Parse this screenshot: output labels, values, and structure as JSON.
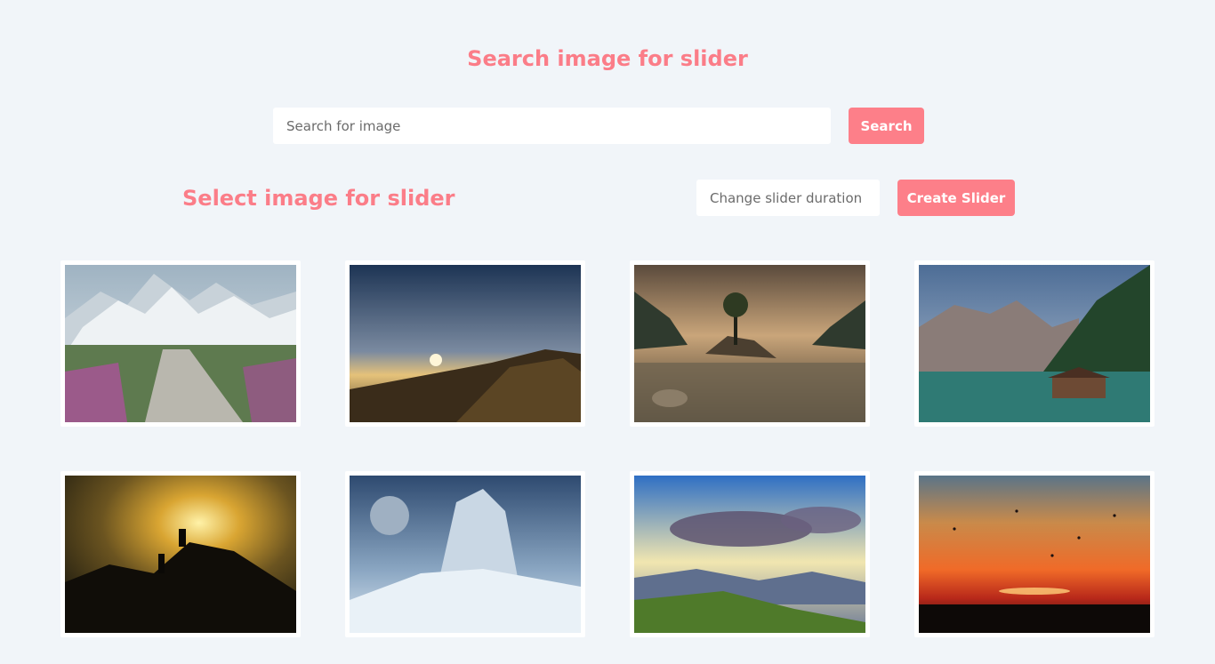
{
  "header": {
    "title": "Search image for slider"
  },
  "search": {
    "placeholder": "Search for image",
    "value": "",
    "button_label": "Search"
  },
  "selection": {
    "title": "Select image for slider",
    "duration_placeholder": "Change slider duration",
    "create_button_label": "Create Slider"
  },
  "colors": {
    "accent": "#fd7f89",
    "background": "#f1f5f9"
  },
  "images": [
    {
      "subject": "snowy-mountain-stone-path"
    },
    {
      "subject": "sunset-above-clouds-mountain"
    },
    {
      "subject": "lake-island-trees-reflection"
    },
    {
      "subject": "mountain-lake-boathouse"
    },
    {
      "subject": "climbers-silhouette-sunset"
    },
    {
      "subject": "ice-giant-moon-fantasy"
    },
    {
      "subject": "sun-rays-clouds-valley"
    },
    {
      "subject": "red-sunset-birds"
    }
  ]
}
